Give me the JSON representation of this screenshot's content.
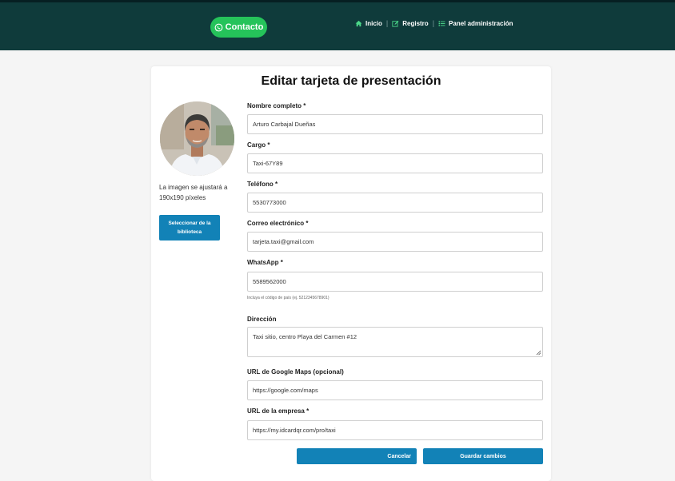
{
  "header": {
    "contact_label": "Contacto",
    "nav": [
      {
        "label": "Inicio",
        "icon": "home-icon"
      },
      {
        "label": "Registro",
        "icon": "edit-icon"
      },
      {
        "label": "Panel administración",
        "icon": "list-icon"
      }
    ],
    "separator": "|",
    "colors": {
      "bar": "#0f3b3b",
      "contact": "#25c35a"
    }
  },
  "form": {
    "title": "Editar tarjeta de presentación",
    "image_note": "La imagen se ajustará a 190x190 píxeles",
    "library_button": "Seleccionar de la biblioteca",
    "fields": {
      "name": {
        "label": "Nombre completo *",
        "value": "Arturo Carbajal Dueñas"
      },
      "position": {
        "label": "Cargo *",
        "value": "Taxi-67Y89"
      },
      "phone": {
        "label": "Teléfono *",
        "value": "5530773000"
      },
      "email": {
        "label": "Correo electrónico *",
        "value": "tarjeta.taxi@gmail.com"
      },
      "whatsapp": {
        "label": "WhatsApp *",
        "value": "5589562000",
        "hint": "Incluya el código de país (ej. 5212345678901)"
      },
      "address": {
        "label": "Dirección",
        "value": "Taxi sitio, centro Playa del Carmen #12"
      },
      "maps": {
        "label": "URL de Google Maps (opcional)",
        "value": "https://google.com/maps"
      },
      "company": {
        "label": "URL de la empresa *",
        "value": "https://my.idcardqr.com/pro/taxi"
      }
    },
    "cancel_label": "Cancelar",
    "save_label": "Guardar cambios",
    "accent": "#1282b7"
  }
}
